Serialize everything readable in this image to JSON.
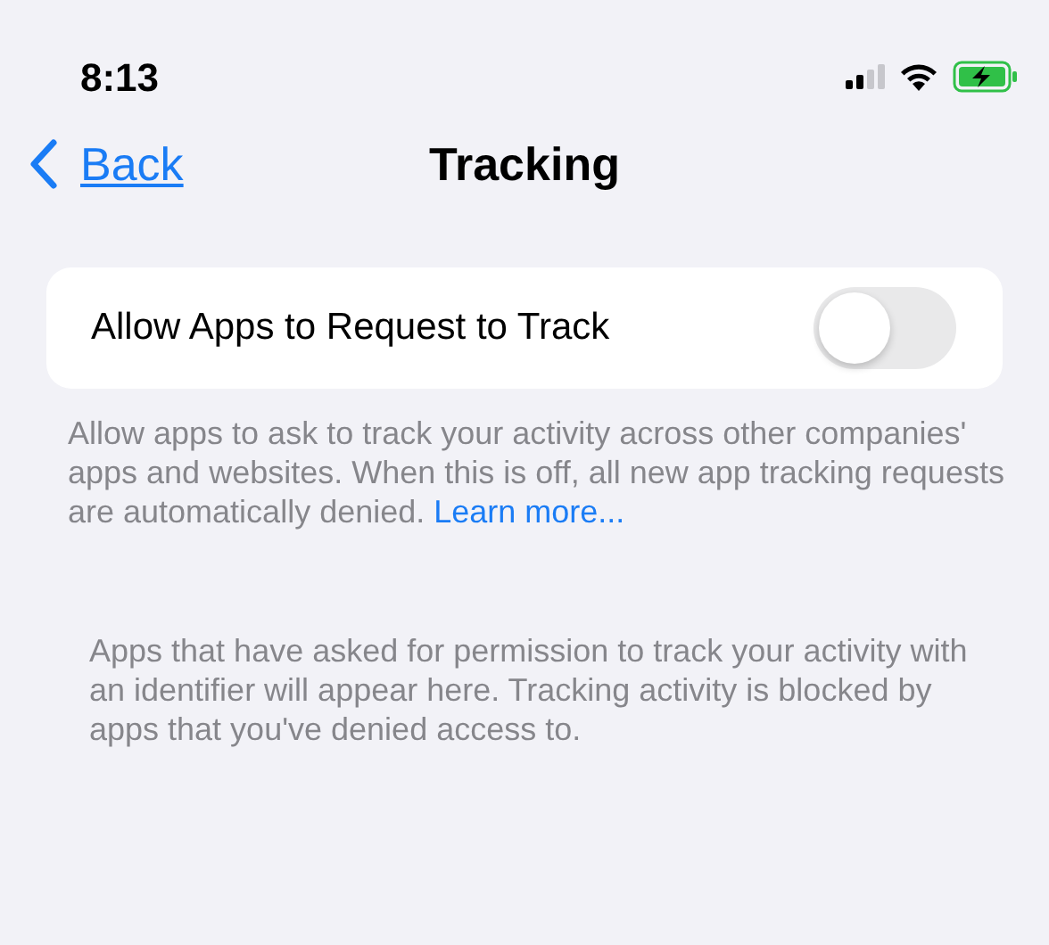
{
  "status_bar": {
    "time": "8:13"
  },
  "nav": {
    "back_label": "Back",
    "title": "Tracking"
  },
  "setting": {
    "label": "Allow Apps to Request to Track",
    "on": false
  },
  "description": {
    "text": "Allow apps to ask to track your activity across other companies' apps and websites. When this is off, all new app tracking requests are automatically denied.",
    "link": "Learn more..."
  },
  "tracking_info": {
    "text": "Apps that have asked for permission to track your activity with an identifier will appear here. Tracking activity is blocked by apps that you've denied access to."
  }
}
